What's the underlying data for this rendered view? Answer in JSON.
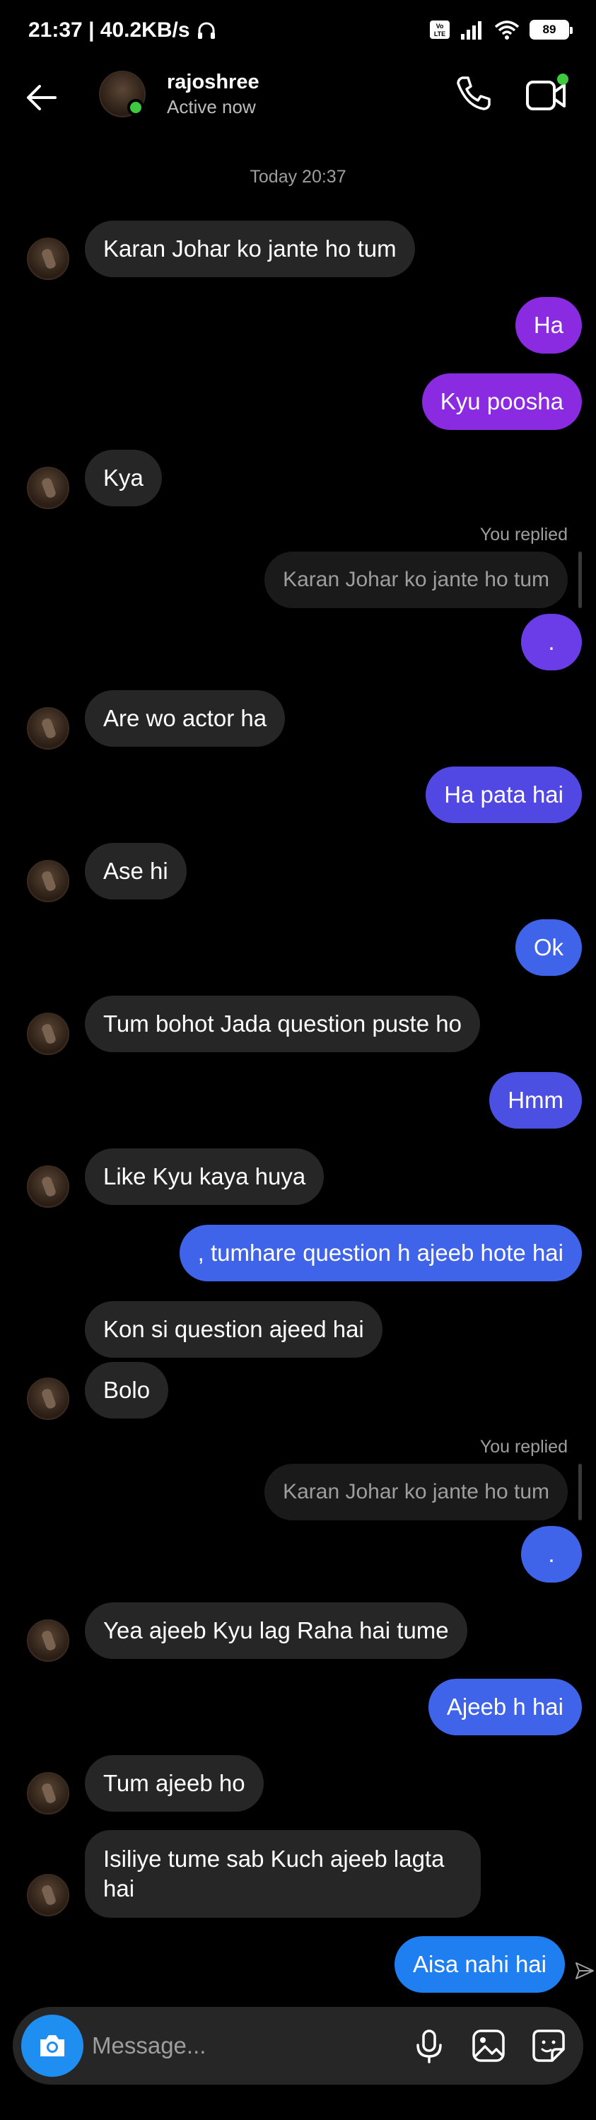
{
  "status_bar": {
    "time_speed": "21:37 | 40.2KB/s",
    "battery": "89",
    "volte": "Vo LTE"
  },
  "header": {
    "name": "rajoshree",
    "status": "Active now"
  },
  "chat": {
    "timestamp": "Today 20:37",
    "messages": [
      {
        "text": "Karan Johar ko jante ho tum"
      },
      {
        "text": "Ha"
      },
      {
        "text": "Kyu poosha"
      },
      {
        "text": "Kya"
      },
      {
        "text": "."
      },
      {
        "text": "Are wo actor ha"
      },
      {
        "text": "Ha pata hai"
      },
      {
        "text": "Ase hi"
      },
      {
        "text": "Ok"
      },
      {
        "text": "Tum bohot Jada question puste ho"
      },
      {
        "text": "Hmm"
      },
      {
        "text": "Like Kyu kaya huya"
      },
      {
        "text": ", tumhare question h ajeeb hote hai"
      },
      {
        "text": "Kon si question ajeed hai"
      },
      {
        "text": "Bolo"
      },
      {
        "text": "."
      },
      {
        "text": "Yea ajeeb Kyu lag Raha hai tume"
      },
      {
        "text": "Ajeeb h hai"
      },
      {
        "text": "Tum ajeeb ho"
      },
      {
        "text": "Isiliye tume sab Kuch ajeeb lagta hai"
      },
      {
        "text": "Aisa nahi hai"
      }
    ],
    "replies": [
      {
        "label": "You replied",
        "quote": "Karan Johar ko jante ho tum"
      },
      {
        "label": "You replied",
        "quote": "Karan Johar ko jante ho tum"
      }
    ]
  },
  "composer": {
    "placeholder": "Message..."
  },
  "colors": {
    "purple": "#8a2be2",
    "violet": "#6a3de8",
    "indigo": "#4b55e0",
    "blue": "#3f64ea",
    "incoming": "#262626"
  },
  "icons": [
    "back-arrow-icon",
    "phone-icon",
    "video-icon",
    "camera-icon",
    "microphone-icon",
    "image-icon",
    "sticker-icon",
    "send-icon"
  ]
}
